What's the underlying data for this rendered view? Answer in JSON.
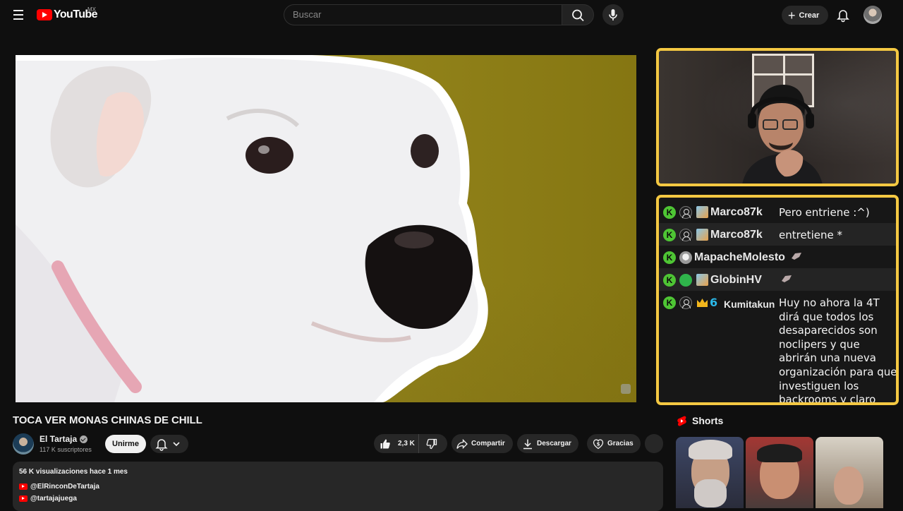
{
  "header": {
    "logo_text": "YouTube",
    "country": "MX",
    "search_placeholder": "Buscar",
    "create_label": "Crear"
  },
  "video": {
    "title": "TOCA VER MONAS CHINAS DE CHILL",
    "channel_name": "El Tartaja",
    "subscribers": "117 K suscriptores",
    "join_label": "Unirme",
    "likes": "2,3 K",
    "share_label": "Compartir",
    "download_label": "Descargar",
    "thanks_label": "Gracias"
  },
  "description": {
    "meta": "56 K visualizaciones  hace 1 mes",
    "links": [
      "@ElRinconDeTartaja",
      "@tartajajuega"
    ]
  },
  "chat": [
    {
      "user": "Marco87k",
      "message": "Pero entriene :^)"
    },
    {
      "user": "Marco87k",
      "message": "entretiene *"
    },
    {
      "user": "MapacheMolesto",
      "message": ""
    },
    {
      "user": "GlobinHV",
      "message": ""
    },
    {
      "user": "Kumitakun",
      "message": "Huy no ahora la 4T dirá que todos los desaparecidos son noclipers y que abrirán una nueva organización para que investiguen los backrooms y claro culpa de los EU y Calderón."
    }
  ],
  "shorts": {
    "title": "Shorts"
  },
  "colors": {
    "accent_red": "#ff0000",
    "overlay_border": "#f4c842",
    "chat_k_badge": "#4ec534"
  }
}
